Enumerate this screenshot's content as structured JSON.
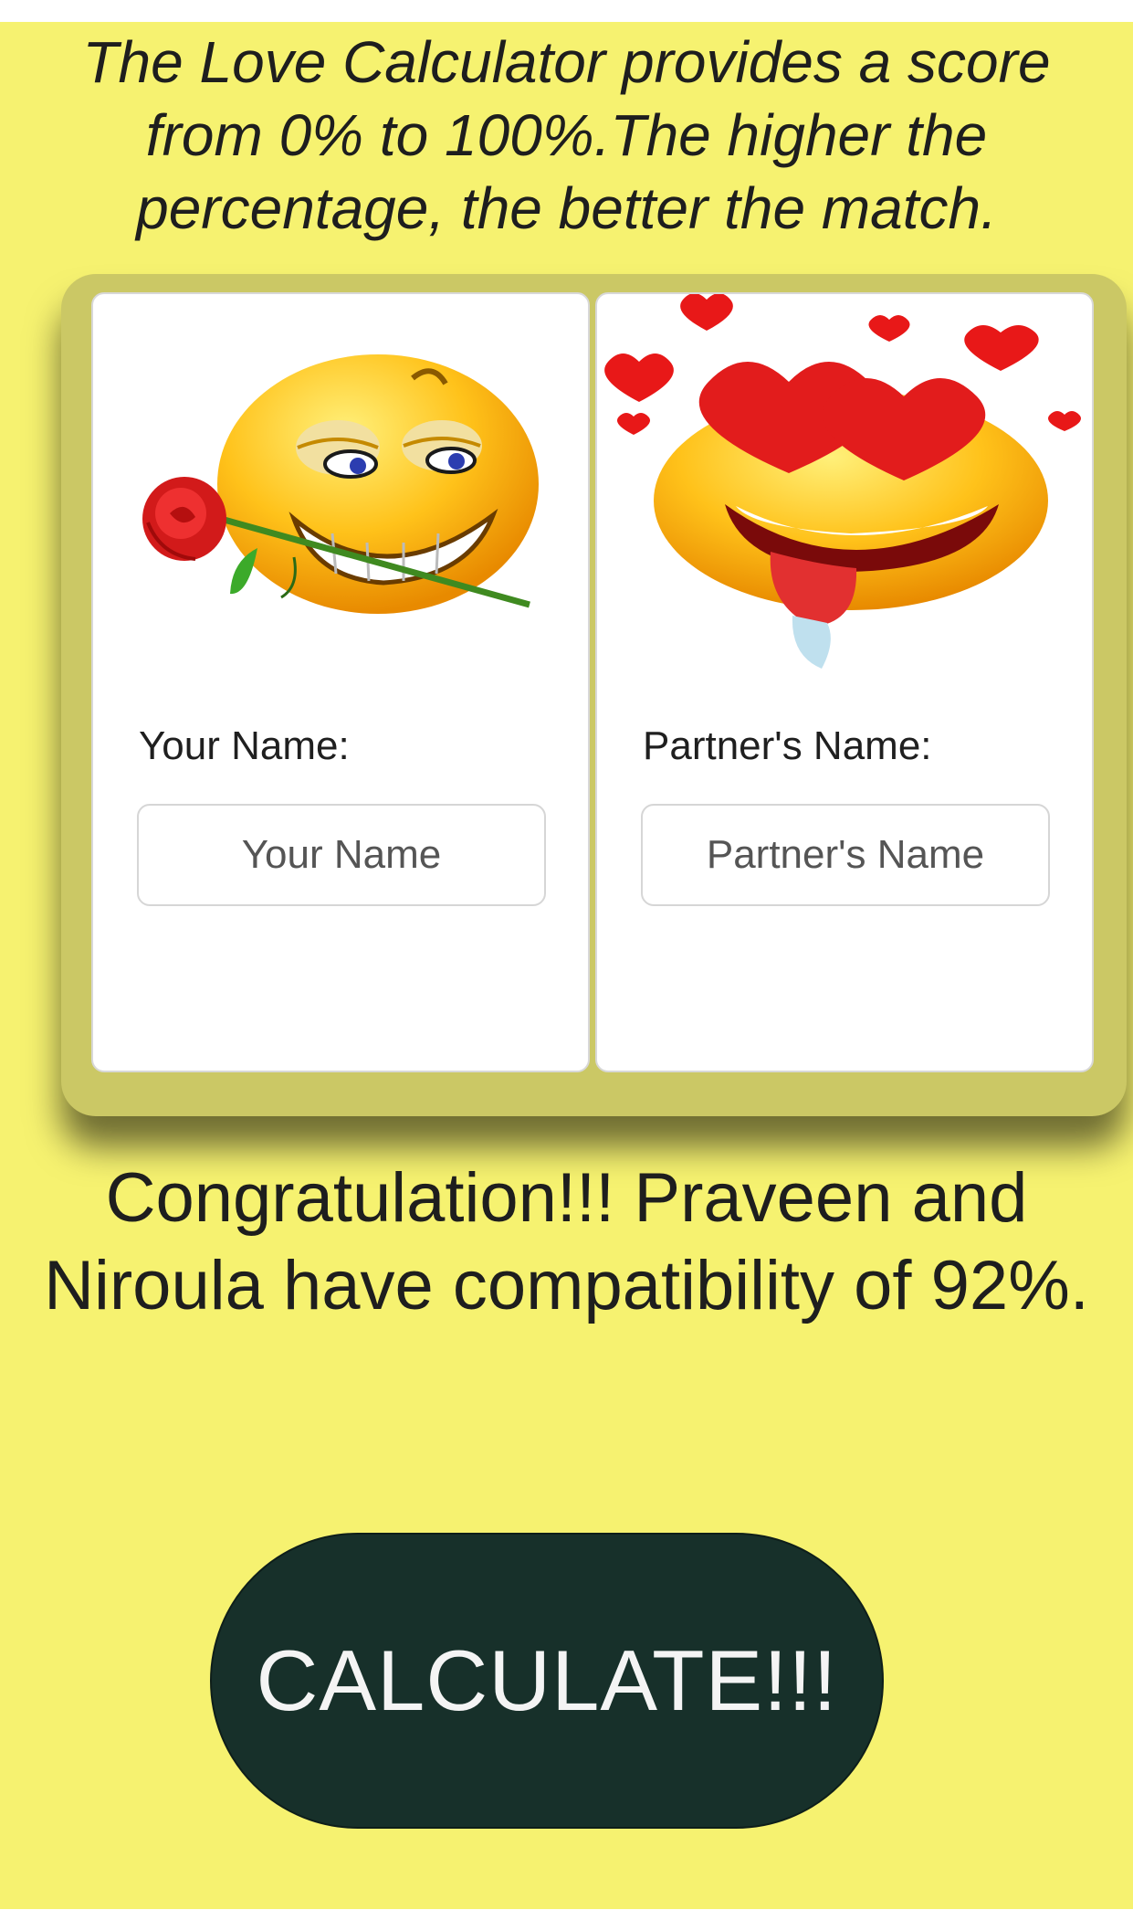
{
  "intro_text": "The Love Calculator provides a score from 0% to 100%.The higher the percentage, the better the match.",
  "your_card": {
    "label": "Your Name:",
    "placeholder": "Your Name",
    "illustration": "smiley-with-rose-icon"
  },
  "partner_card": {
    "label": "Partner's Name:",
    "placeholder": "Partner's Name",
    "illustration": "smiley-with-hearts-icon"
  },
  "result_text": "Congratulation!!! Praveen and Niroula have compatibility of 92%.",
  "calculate_label": "CALCULATE!!!",
  "colors": {
    "page_background": "#f6f270",
    "panel_background": "#cbc865",
    "button_background": "#17302a",
    "button_text": "#f4f4f4"
  }
}
